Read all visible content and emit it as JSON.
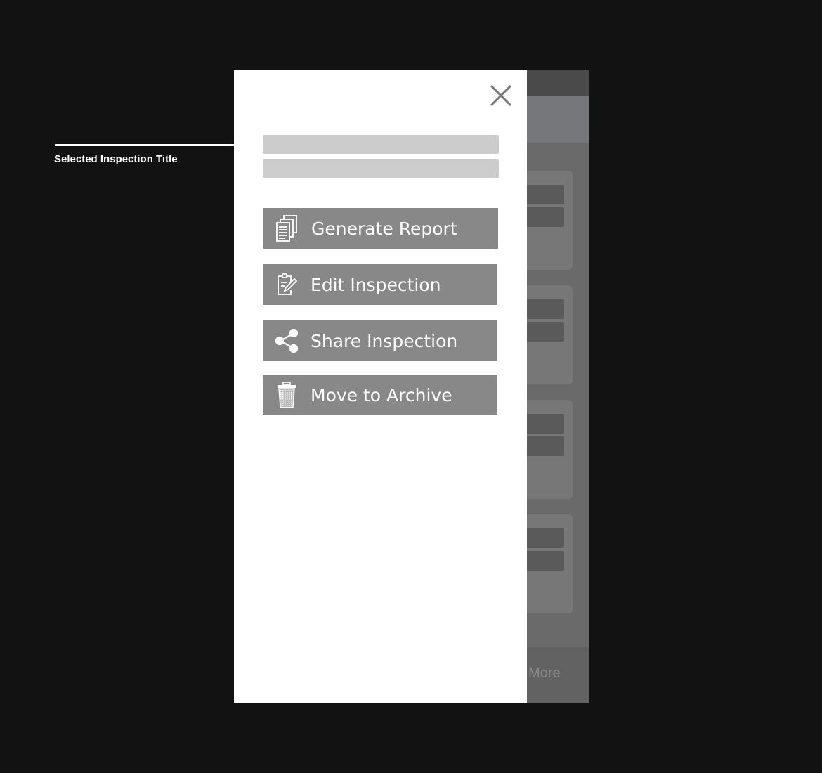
{
  "annotation": {
    "label": "Selected Inspection Title"
  },
  "background_screen": {
    "bottom_nav_more_label": "More"
  },
  "drawer": {
    "close_icon": "close-icon",
    "actions": [
      {
        "label": "Generate Report",
        "icon": "documents-icon"
      },
      {
        "label": "Edit Inspection",
        "icon": "edit-document-icon"
      },
      {
        "label": "Share Inspection",
        "icon": "share-icon"
      },
      {
        "label": "Move to Archive",
        "icon": "trash-icon"
      }
    ]
  },
  "colors": {
    "page_background": "#121212",
    "drawer_background": "#ffffff",
    "action_button": "#888888",
    "placeholder_bar": "#cccccc",
    "close_icon": "#777777"
  }
}
